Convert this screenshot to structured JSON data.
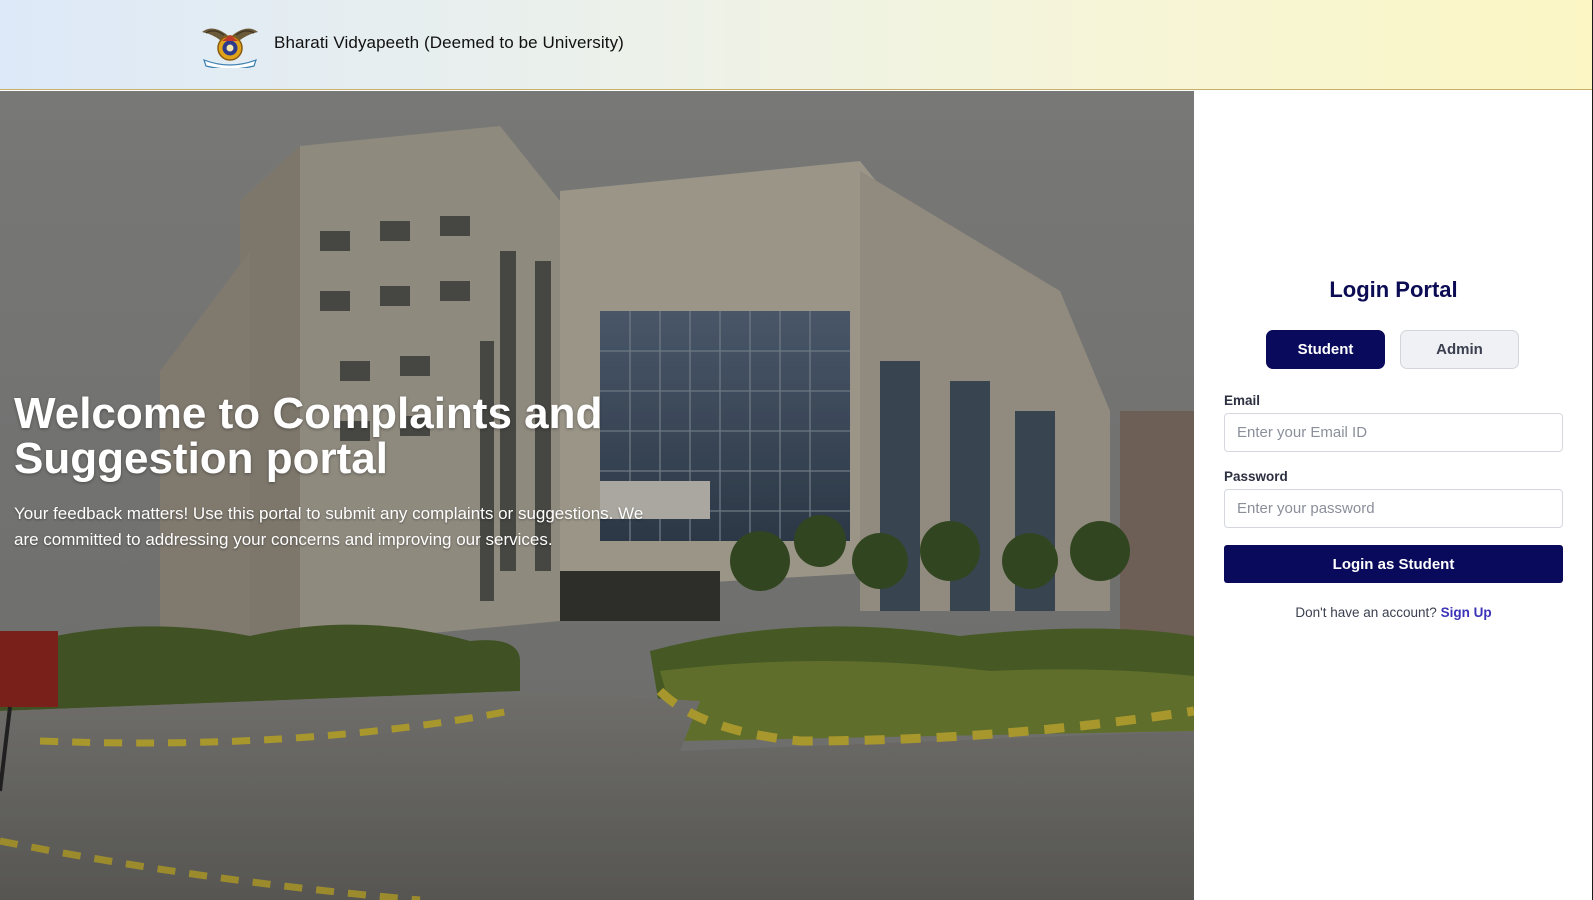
{
  "header": {
    "university_name": "Bharati Vidyapeeth (Deemed to be University)",
    "logo_icon": "university-emblem-icon"
  },
  "hero": {
    "title": "Welcome to Complaints and Suggestion portal",
    "description": "Your feedback matters! Use this portal to submit any complaints or suggestions. We are committed to addressing your concerns and improving our services.",
    "background": "campus-building-photo"
  },
  "login": {
    "title": "Login Portal",
    "tabs": [
      {
        "label": "Student",
        "active": true
      },
      {
        "label": "Admin",
        "active": false
      }
    ],
    "email_label": "Email",
    "email_placeholder": "Enter your Email ID",
    "email_value": "",
    "password_label": "Password",
    "password_placeholder": "Enter your password",
    "password_value": "",
    "submit_label": "Login as Student",
    "signup_prompt": "Don't have an account?",
    "signup_link": "Sign Up"
  },
  "colors": {
    "primary": "#0a0a5c",
    "link": "#3b33b8",
    "header_gradient_start": "#dde9f8",
    "header_gradient_end": "#fbf6c4"
  }
}
